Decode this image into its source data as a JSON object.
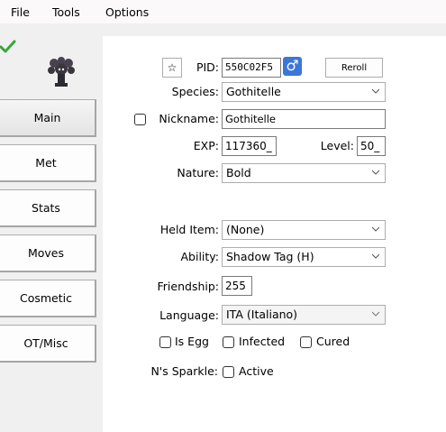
{
  "menu": {
    "file": "File",
    "tools": "Tools",
    "options": "Options"
  },
  "nav": [
    "Main",
    "Met",
    "Stats",
    "Moves",
    "Cosmetic",
    "OT/Misc"
  ],
  "main": {
    "star_label": "☆",
    "pid_label": "PID:",
    "pid_value": "550C02F5",
    "gender_symbol": "♂",
    "reroll_label": "Reroll",
    "species_label": "Species:",
    "species_value": "Gothitelle",
    "nickname_label": "Nickname:",
    "nickname_value": "Gothitelle",
    "exp_label": "EXP:",
    "exp_value": "117360_",
    "level_label": "Level:",
    "level_value": "50_",
    "nature_label": "Nature:",
    "nature_value": "Bold",
    "held_item_label": "Held Item:",
    "held_item_value": "(None)",
    "ability_label": "Ability:",
    "ability_value": "Shadow Tag (H)",
    "friendship_label": "Friendship:",
    "friendship_value": "255",
    "language_label": "Language:",
    "language_value": "ITA (Italiano)",
    "is_egg_label": "Is Egg",
    "infected_label": "Infected",
    "cured_label": "Cured",
    "sparkle_label": "N's Sparkle:",
    "active_label": "Active"
  },
  "colors": {
    "accent": "#f08a2c",
    "gender": "#3b77d8",
    "check": "#3aa53a"
  }
}
